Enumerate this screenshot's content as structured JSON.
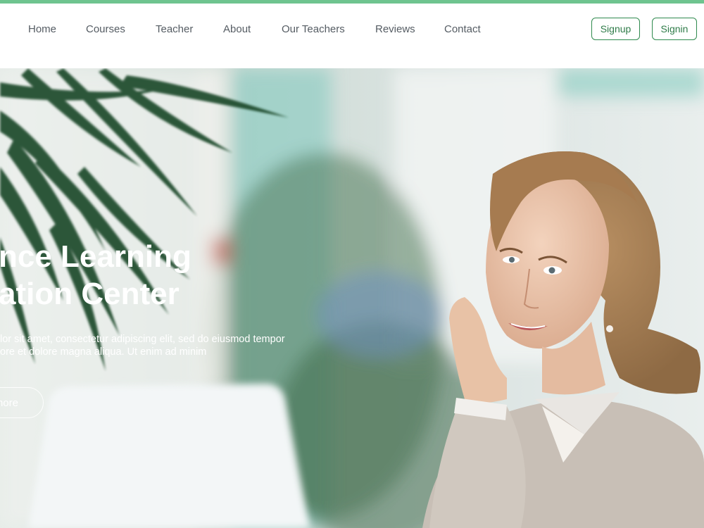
{
  "colors": {
    "accent_bar": "#6ec48f",
    "button_border": "#2f8a4e",
    "nav_text": "#555c63"
  },
  "nav": {
    "items": [
      {
        "label": "Home"
      },
      {
        "label": "Courses"
      },
      {
        "label": "Teacher"
      },
      {
        "label": "About"
      },
      {
        "label": "Our Teachers"
      },
      {
        "label": "Reviews"
      },
      {
        "label": "Contact"
      }
    ]
  },
  "auth": {
    "signup_label": "Signup",
    "signin_label": "Signin"
  },
  "hero": {
    "title_line1": "nce Learning",
    "title_line2": "ation Center",
    "text_line1": "lor sit amet, consectetur adipiscing elit, sed do eiusmod tempor",
    "text_line2": "ore et dolore magna aliqua. Ut enim ad minim",
    "button_label": "nore",
    "image": "woman-at-laptop-photo"
  }
}
